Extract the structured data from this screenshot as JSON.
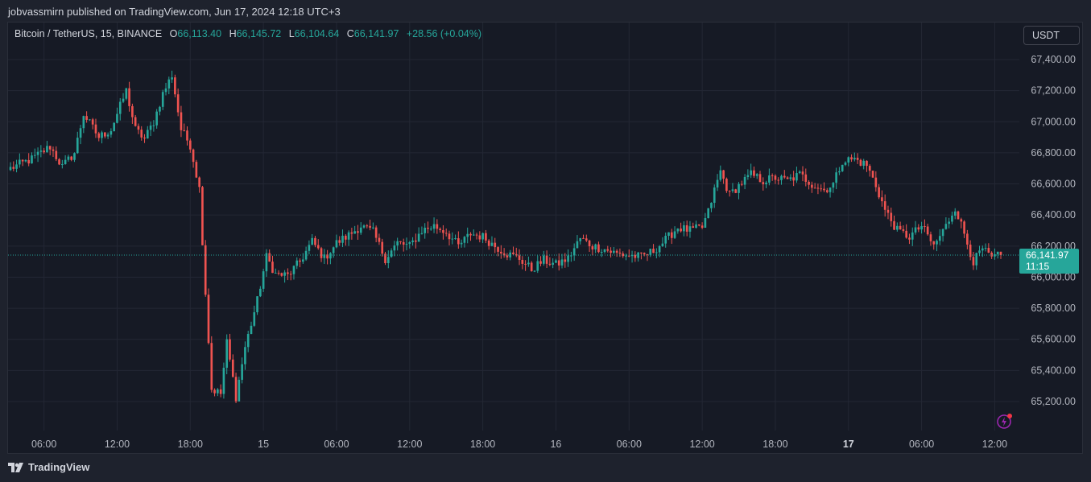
{
  "caption": "jobvassmirn published on TradingView.com, Jun 17, 2024 12:18 UTC+3",
  "legend": {
    "symbol": "Bitcoin / TetherUS, 15, BINANCE",
    "open_label": "O",
    "open": "66,113.40",
    "high_label": "H",
    "high": "66,145.72",
    "low_label": "L",
    "low": "66,104.64",
    "close_label": "C",
    "close": "66,141.97",
    "change": "+28.56 (+0.04%)"
  },
  "currency_button": "USDT",
  "price_tag": {
    "price": "66,141.97",
    "countdown": "11:15"
  },
  "footer": {
    "brand": "TradingView"
  },
  "colors": {
    "up": "#26a69a",
    "down": "#ef5350",
    "background": "#161a25",
    "grid": "#232734",
    "axis_text": "#b2b5be"
  },
  "icons": [
    "flash-icon",
    "tradingview-logo-icon"
  ],
  "chart_data": {
    "type": "candlestick",
    "symbol": "BTCUSDT",
    "interval": "15",
    "current_price": 66141.97,
    "y_ticks": [
      "67,400.00",
      "67,200.00",
      "67,000.00",
      "66,800.00",
      "66,600.00",
      "66,400.00",
      "66,200.00",
      "66,000.00",
      "65,800.00",
      "65,600.00",
      "65,400.00",
      "65,200.00"
    ],
    "x_ticks": [
      "06:00",
      "12:00",
      "18:00",
      "15",
      "06:00",
      "12:00",
      "18:00",
      "16",
      "06:00",
      "12:00",
      "18:00",
      "17",
      "06:00",
      "12:00"
    ],
    "bold_x_ticks": [
      "17"
    ],
    "ylim": [
      65050,
      67480
    ],
    "x_range": [
      "2024-06-14 03:15",
      "2024-06-17 12:30"
    ],
    "close_path": [
      [
        "2024-06-14 03:15",
        66700
      ],
      [
        "2024-06-14 05:00",
        66760
      ],
      [
        "2024-06-14 06:30",
        66840
      ],
      [
        "2024-06-14 07:30",
        66710
      ],
      [
        "2024-06-14 08:30",
        66800
      ],
      [
        "2024-06-14 09:15",
        67050
      ],
      [
        "2024-06-14 10:30",
        66900
      ],
      [
        "2024-06-14 11:30",
        66950
      ],
      [
        "2024-06-14 12:45",
        67200
      ],
      [
        "2024-06-14 13:30",
        66950
      ],
      [
        "2024-06-14 14:15",
        66890
      ],
      [
        "2024-06-14 15:00",
        67000
      ],
      [
        "2024-06-14 15:45",
        67180
      ],
      [
        "2024-06-14 16:30",
        67300
      ],
      [
        "2024-06-14 17:15",
        66950
      ],
      [
        "2024-06-14 18:00",
        66850
      ],
      [
        "2024-06-14 18:45",
        66570
      ],
      [
        "2024-06-14 19:15",
        65900
      ],
      [
        "2024-06-14 19:45",
        65280
      ],
      [
        "2024-06-14 20:30",
        65250
      ],
      [
        "2024-06-14 21:00",
        65580
      ],
      [
        "2024-06-14 21:45",
        65230
      ],
      [
        "2024-06-14 22:30",
        65550
      ],
      [
        "2024-06-14 23:30",
        65850
      ],
      [
        "2024-06-15 00:15",
        66130
      ],
      [
        "2024-06-15 01:00",
        66020
      ],
      [
        "2024-06-15 02:00",
        66010
      ],
      [
        "2024-06-15 03:00",
        66100
      ],
      [
        "2024-06-15 04:00",
        66230
      ],
      [
        "2024-06-15 05:00",
        66120
      ],
      [
        "2024-06-15 06:00",
        66220
      ],
      [
        "2024-06-15 07:00",
        66270
      ],
      [
        "2024-06-15 08:00",
        66330
      ],
      [
        "2024-06-15 09:00",
        66290
      ],
      [
        "2024-06-15 10:00",
        66120
      ],
      [
        "2024-06-15 11:00",
        66220
      ],
      [
        "2024-06-15 12:00",
        66200
      ],
      [
        "2024-06-15 13:00",
        66300
      ],
      [
        "2024-06-15 14:00",
        66330
      ],
      [
        "2024-06-15 15:00",
        66290
      ],
      [
        "2024-06-15 16:00",
        66200
      ],
      [
        "2024-06-15 17:00",
        66280
      ],
      [
        "2024-06-15 18:00",
        66260
      ],
      [
        "2024-06-15 19:00",
        66200
      ],
      [
        "2024-06-15 20:00",
        66150
      ],
      [
        "2024-06-15 21:00",
        66120
      ],
      [
        "2024-06-15 22:00",
        66050
      ],
      [
        "2024-06-15 23:00",
        66110
      ],
      [
        "2024-06-16 00:00",
        66080
      ],
      [
        "2024-06-16 01:00",
        66120
      ],
      [
        "2024-06-16 02:00",
        66250
      ],
      [
        "2024-06-16 03:00",
        66200
      ],
      [
        "2024-06-16 04:00",
        66180
      ],
      [
        "2024-06-16 05:00",
        66150
      ],
      [
        "2024-06-16 06:00",
        66140
      ],
      [
        "2024-06-16 07:00",
        66130
      ],
      [
        "2024-06-16 08:00",
        66170
      ],
      [
        "2024-06-16 09:00",
        66240
      ],
      [
        "2024-06-16 10:00",
        66320
      ],
      [
        "2024-06-16 11:00",
        66300
      ],
      [
        "2024-06-16 12:00",
        66320
      ],
      [
        "2024-06-16 12:30",
        66420
      ],
      [
        "2024-06-16 13:00",
        66560
      ],
      [
        "2024-06-16 13:30",
        66680
      ],
      [
        "2024-06-16 14:15",
        66530
      ],
      [
        "2024-06-16 15:00",
        66590
      ],
      [
        "2024-06-16 16:00",
        66660
      ],
      [
        "2024-06-16 17:00",
        66620
      ],
      [
        "2024-06-16 18:00",
        66640
      ],
      [
        "2024-06-16 19:00",
        66620
      ],
      [
        "2024-06-16 20:00",
        66660
      ],
      [
        "2024-06-16 21:00",
        66600
      ],
      [
        "2024-06-16 22:00",
        66560
      ],
      [
        "2024-06-16 22:45",
        66600
      ],
      [
        "2024-06-16 23:30",
        66750
      ],
      [
        "2024-06-17 00:30",
        66760
      ],
      [
        "2024-06-17 01:30",
        66720
      ],
      [
        "2024-06-17 02:15",
        66590
      ],
      [
        "2024-06-17 03:00",
        66430
      ],
      [
        "2024-06-17 04:00",
        66300
      ],
      [
        "2024-06-17 05:00",
        66260
      ],
      [
        "2024-06-17 06:00",
        66330
      ],
      [
        "2024-06-17 07:00",
        66200
      ],
      [
        "2024-06-17 08:00",
        66330
      ],
      [
        "2024-06-17 08:45",
        66450
      ],
      [
        "2024-06-17 09:30",
        66280
      ],
      [
        "2024-06-17 10:15",
        66100
      ],
      [
        "2024-06-17 11:00",
        66180
      ],
      [
        "2024-06-17 11:45",
        66120
      ],
      [
        "2024-06-17 12:30",
        66142
      ]
    ]
  }
}
